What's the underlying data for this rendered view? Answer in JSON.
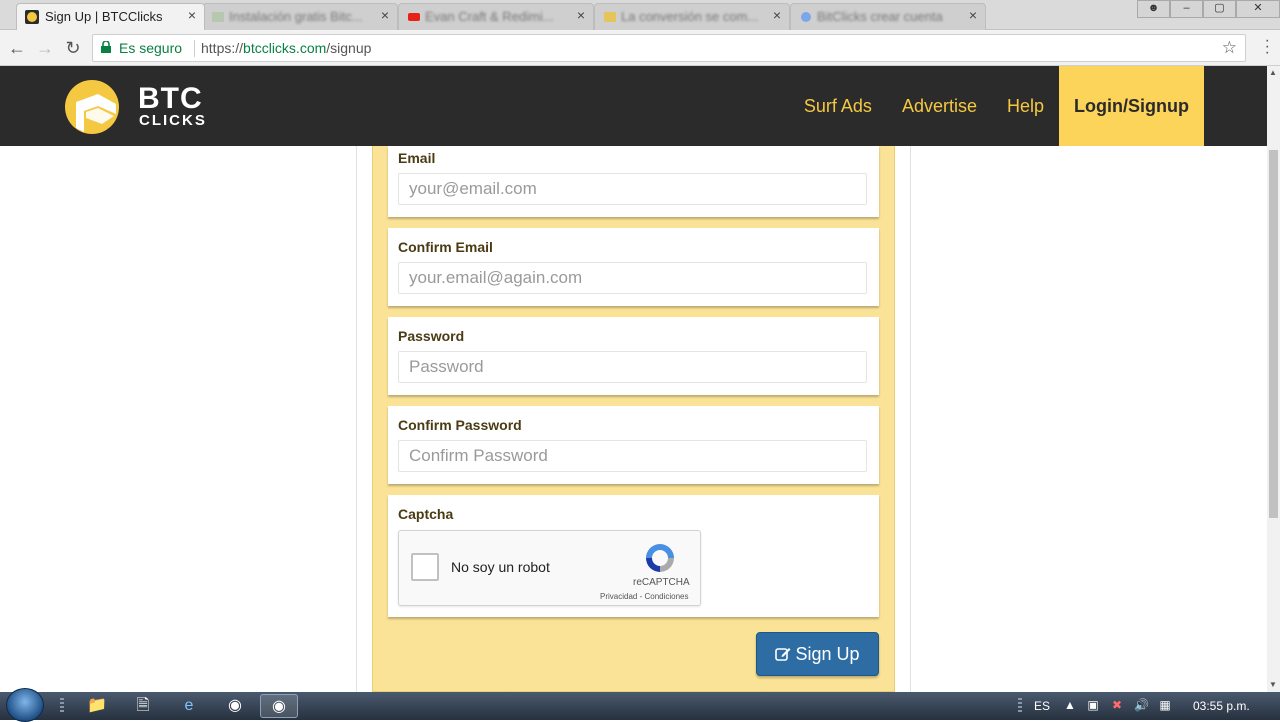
{
  "browser": {
    "tabs": [
      {
        "title": "Sign Up | BTCClicks",
        "close": "×",
        "active": true
      },
      {
        "title": "Instalación gratis Bitc...",
        "close": "×",
        "active": false
      },
      {
        "title": "Evan Craft & Redimi...",
        "close": "×",
        "active": false
      },
      {
        "title": "La conversión se com...",
        "close": "×",
        "active": false
      },
      {
        "title": "BitClicks crear cuenta",
        "close": "×",
        "active": false
      }
    ],
    "window_controls": {
      "minimize": "–",
      "maximize": "▢",
      "close": "✕"
    },
    "security_label": "Es seguro",
    "url_scheme": "https://",
    "url_host": "btcclicks.com",
    "url_path": "/signup",
    "nav_icons": [
      "back-arrow-icon",
      "forward-arrow-icon",
      "reload-icon",
      "star-icon",
      "menu-icon"
    ]
  },
  "site": {
    "logo_line1": "BTC",
    "logo_line2": "CLICKS",
    "nav": [
      {
        "label": "Surf Ads"
      },
      {
        "label": "Advertise"
      },
      {
        "label": "Help"
      },
      {
        "label": "Login/Signup",
        "active": true
      }
    ],
    "colors": {
      "header_bg": "#2b2b2b",
      "accent": "#f5c842",
      "active_nav": "#fcd45a",
      "panel": "#fae396",
      "button": "#2e6da4"
    }
  },
  "form": {
    "fields": [
      {
        "label": "Email",
        "placeholder": "your@email.com",
        "type": "text"
      },
      {
        "label": "Confirm Email",
        "placeholder": "your.email@again.com",
        "type": "text"
      },
      {
        "label": "Password",
        "placeholder": "Password",
        "type": "password"
      },
      {
        "label": "Confirm Password",
        "placeholder": "Confirm Password",
        "type": "password"
      }
    ],
    "captcha": {
      "label": "Captcha",
      "checkbox_label": "No soy un robot",
      "brand": "reCAPTCHA",
      "links": "Privacidad - Condiciones"
    },
    "submit_label": "Sign Up"
  },
  "taskbar": {
    "language": "ES",
    "time": "03:55 p.m."
  }
}
